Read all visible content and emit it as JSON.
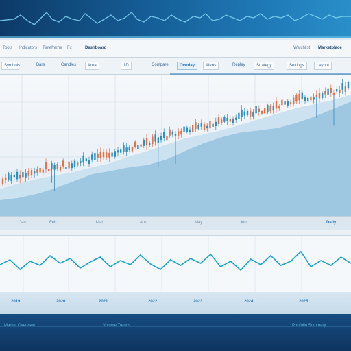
{
  "header": {
    "accent": "#69c6ec"
  },
  "menu": {
    "items": [
      "Tools",
      "Indicators",
      "Timeframe",
      "Fx",
      "Dashboard"
    ],
    "right_items": [
      "Watchlist",
      "Marketplace"
    ]
  },
  "toolbar": {
    "items": [
      "Symbols",
      "Bars",
      "Candles",
      "Area",
      "1D",
      "Compare",
      "Overlay",
      "Alerts",
      "Replay",
      "Strategy",
      "Settings",
      "Layout"
    ],
    "selected_index": 5
  },
  "main_axis": {
    "ticks": [
      "Jan",
      "Feb",
      "Mar",
      "Apr",
      "May",
      "Jun"
    ],
    "right_label": "Daily"
  },
  "lower_axis": {
    "ticks": [
      "2019",
      "2020",
      "2021",
      "2022",
      "2023",
      "2024",
      "2025"
    ]
  },
  "footer": {
    "left_label": "Market Overview",
    "mid_label": "Volume Trends",
    "right_label": "Portfolio Summary"
  },
  "colors": {
    "up": "#e0734a",
    "down": "#2f8fbf",
    "fill": "#a9cfe6",
    "line": "#1aa3c8"
  },
  "chart_data": [
    {
      "type": "line",
      "title": "",
      "series_trend": [
        270,
        262,
        255,
        250,
        245,
        238,
        232,
        222,
        214,
        205,
        196,
        190,
        184,
        176,
        168,
        160,
        152,
        146,
        140,
        132
      ]
    },
    {
      "type": "line",
      "title": "",
      "values": [
        385,
        378,
        392,
        380,
        386,
        372,
        383,
        376,
        390,
        381,
        374,
        388,
        379,
        385,
        371,
        384,
        392,
        378,
        386,
        376,
        383,
        370,
        388,
        380,
        393,
        377,
        385,
        372,
        386,
        380,
        366,
        388,
        379,
        386,
        374,
        383
      ]
    }
  ]
}
